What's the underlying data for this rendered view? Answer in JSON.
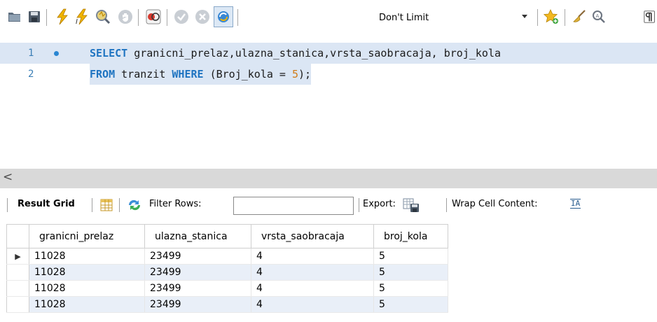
{
  "toolbar": {
    "icons": [
      "open-folder-icon",
      "save-icon",
      "execute-lightning-icon",
      "execute-current-icon",
      "explain-magnifier-icon",
      "stop-icon",
      "toggle-error-icon",
      "commit-icon",
      "rollback-icon",
      "autocommit-icon",
      "favorite-star-icon",
      "beautify-broom-icon",
      "find-icon",
      "invisible-chars-icon"
    ],
    "limit_value": "Don't Limit"
  },
  "editor": {
    "lines": [
      {
        "number": "1",
        "has_marker": true
      },
      {
        "number": "2",
        "has_marker": false
      }
    ],
    "line1": {
      "kw1": "SELECT",
      "rest": " granicni_prelaz,ulazna_stanica,vrsta_saobracaja, broj_kola"
    },
    "line2": {
      "kw1": "FROM",
      "mid1": " tranzit ",
      "kw2": "WHERE",
      "mid2": " (Broj_kola = ",
      "num": "5",
      "end": ");"
    }
  },
  "scrollbar": {
    "left_arrow": "<"
  },
  "results_toolbar": {
    "result_grid": "Result Grid",
    "filter_rows": "Filter Rows:",
    "filter_value": "",
    "export": "Export:",
    "wrap_cell": "Wrap Cell Content:",
    "wrap_icon_glyph": "IA"
  },
  "table": {
    "columns": [
      "granicni_prelaz",
      "ulazna_stanica",
      "vrsta_saobracaja",
      "broj_kola"
    ],
    "rows": [
      [
        "11028",
        "23499",
        "4",
        "5"
      ],
      [
        "11028",
        "23499",
        "4",
        "5"
      ],
      [
        "11028",
        "23499",
        "4",
        "5"
      ],
      [
        "11028",
        "23499",
        "4",
        "5"
      ]
    ],
    "row_marker": "▶"
  }
}
